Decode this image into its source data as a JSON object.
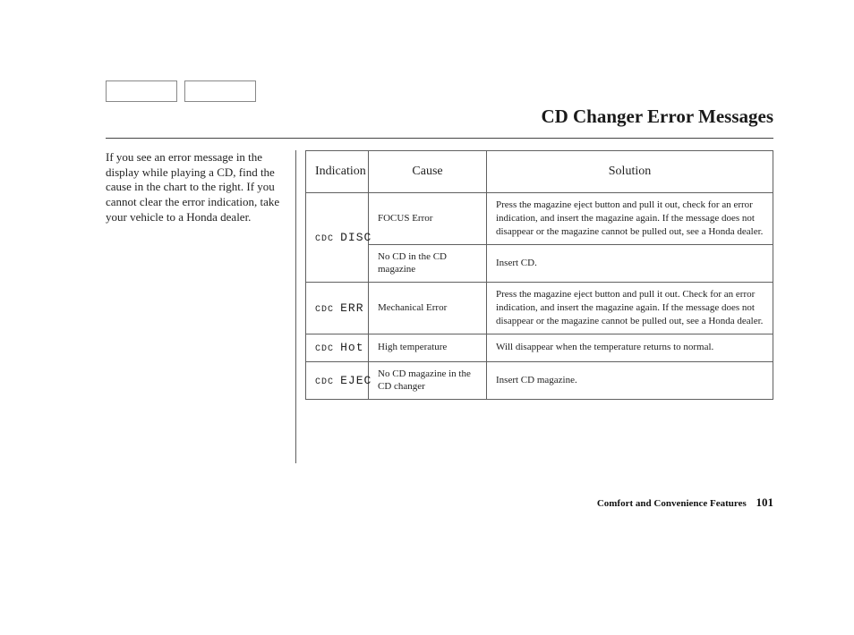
{
  "title": "CD Changer Error Messages",
  "intro": "If you see an error message in the display while playing a CD, find the cause in the chart to the right. If you cannot clear the error indication, take your vehicle to a Honda dealer.",
  "table": {
    "headers": {
      "indication": "Indication",
      "cause": "Cause",
      "solution": "Solution"
    },
    "rows": [
      {
        "indication_prefix": "CDC",
        "indication_code": "DISC",
        "entries": [
          {
            "cause": "FOCUS Error",
            "solution": "Press the magazine eject button and pull it out, check for an error indication, and insert the magazine again. If the message does not disappear or the magazine cannot be pulled out, see a Honda dealer."
          },
          {
            "cause": "No CD in the CD magazine",
            "solution": "Insert CD."
          }
        ]
      },
      {
        "indication_prefix": "CDC",
        "indication_code": "ERR",
        "entries": [
          {
            "cause": "Mechanical Error",
            "solution": "Press the magazine eject button and pull it out. Check for an error indication, and insert the magazine again. If the message does not disappear or the magazine cannot be pulled out, see a Honda dealer."
          }
        ]
      },
      {
        "indication_prefix": "CDC",
        "indication_code": "Hot",
        "entries": [
          {
            "cause": "High temperature",
            "solution": "Will disappear when the temperature returns to normal."
          }
        ]
      },
      {
        "indication_prefix": "CDC",
        "indication_code": "EJEC",
        "entries": [
          {
            "cause": "No CD magazine in the CD changer",
            "solution": "Insert CD magazine."
          }
        ]
      }
    ]
  },
  "footer": {
    "section": "Comfort and Convenience Features",
    "page_number": "101"
  }
}
